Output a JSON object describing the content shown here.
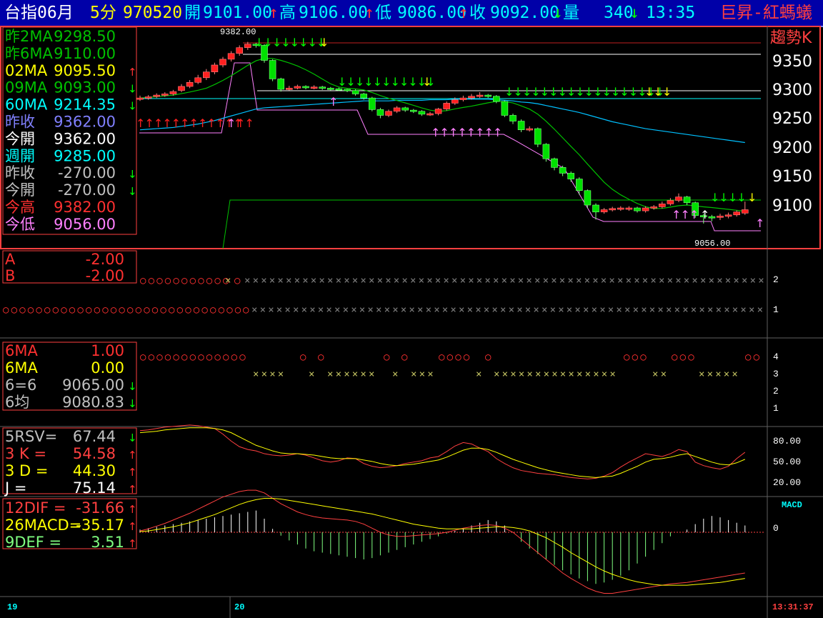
{
  "header": {
    "symbol": "台指06月",
    "period": "5分",
    "date": "970520",
    "open_label": "開",
    "open": "9101.00",
    "high_label": "高",
    "high": "9106.00",
    "low_label": "低",
    "low": "9086.00",
    "close_label": "收",
    "close": "9092.00",
    "volume_label": "量",
    "volume": "340",
    "time": "13:35",
    "brand": "巨昇-紅螞蟻"
  },
  "main_panel": {
    "mode_label": "趨勢K",
    "high_marker": "9382.00",
    "low_marker": "9056.00",
    "y_ticks": [
      "9350",
      "9300",
      "9250",
      "9200",
      "9150",
      "9100"
    ],
    "legend": [
      {
        "label": "昨2MA",
        "value": "9298.50",
        "color": "#00c000",
        "arrow": ""
      },
      {
        "label": "昨6MA",
        "value": "9110.00",
        "color": "#00c000",
        "arrow": ""
      },
      {
        "label": "02MA",
        "value": "9095.50",
        "color": "#ffff00",
        "arrow": "up"
      },
      {
        "label": "09MA",
        "value": "9093.00",
        "color": "#00c000",
        "arrow": "down"
      },
      {
        "label": "60MA",
        "value": "9214.35",
        "color": "#00ffff",
        "arrow": "down"
      },
      {
        "label": "昨收",
        "value": "9362.00",
        "color": "#8080ff",
        "arrow": ""
      },
      {
        "label": "今開",
        "value": "9362.00",
        "color": "#ffffff",
        "arrow": ""
      },
      {
        "label": "週開",
        "value": "9285.00",
        "color": "#00ffff",
        "arrow": ""
      },
      {
        "label": "昨收",
        "value": "-270.00",
        "color": "#c0c0c0",
        "arrow": "down"
      },
      {
        "label": "今開",
        "value": "-270.00",
        "color": "#c0c0c0",
        "arrow": "down"
      },
      {
        "label": "今高",
        "value": "9382.00",
        "color": "#ff3030",
        "arrow": ""
      },
      {
        "label": "今低",
        "value": "9056.00",
        "color": "#ff80ff",
        "arrow": ""
      }
    ]
  },
  "signal_panel_1": {
    "legend": [
      {
        "label": "A",
        "value": "-2.00",
        "color": "#ff3030"
      },
      {
        "label": "B",
        "value": "-2.00",
        "color": "#ff3030"
      }
    ],
    "y_ticks": [
      "2",
      "1"
    ]
  },
  "signal_panel_2": {
    "legend": [
      {
        "label": "6MA",
        "value": "1.00",
        "color": "#ff3030",
        "arrow": ""
      },
      {
        "label": "6MA",
        "value": "0.00",
        "color": "#ffff00",
        "arrow": ""
      },
      {
        "label": "6=6",
        "value": "9065.00",
        "color": "#c0c0c0",
        "arrow": "down"
      },
      {
        "label": "6均",
        "value": "9080.83",
        "color": "#c0c0c0",
        "arrow": "down"
      }
    ],
    "y_ticks": [
      "4",
      "3",
      "2",
      "1"
    ]
  },
  "kd_panel": {
    "legend": [
      {
        "label": "5RSV=",
        "value": "67.44",
        "color": "#c0c0c0",
        "arrow": "down"
      },
      {
        "label": "3 K =",
        "value": "54.58",
        "color": "#ff4040",
        "arrow": "up"
      },
      {
        "label": "3 D =",
        "value": "44.30",
        "color": "#ffff00",
        "arrow": "up"
      },
      {
        "label": "J =",
        "value": "75.14",
        "color": "#ffffff",
        "arrow": "up"
      }
    ],
    "y_ticks": [
      "80.00",
      "50.00",
      "20.00"
    ]
  },
  "macd_panel": {
    "title": "MACD",
    "legend": [
      {
        "label": "12DIF =",
        "value": "-31.66",
        "color": "#ff4040",
        "arrow": "up"
      },
      {
        "label": "26MACD=",
        "value": "-35.17",
        "color": "#ffff00",
        "arrow": "up"
      },
      {
        "label": "9DEF =",
        "value": "3.51",
        "color": "#80ff80",
        "arrow": "up"
      }
    ],
    "y_ticks": [
      "0"
    ]
  },
  "footer": {
    "day_1": "19",
    "day_2": "20",
    "clock": "13:31:37"
  },
  "chart_data": {
    "type": "candlestick",
    "close": [
      9285,
      9287,
      9290,
      9292,
      9296,
      9305,
      9312,
      9320,
      9330,
      9342,
      9352,
      9362,
      9372,
      9378,
      9376,
      9350,
      9318,
      9300,
      9302,
      9305,
      9303,
      9304,
      9302,
      9301,
      9300,
      9298,
      9292,
      9285,
      9265,
      9255,
      9262,
      9268,
      9264,
      9262,
      9257,
      9258,
      9266,
      9276,
      9282,
      9285,
      9288,
      9290,
      9288,
      9279,
      9255,
      9245,
      9230,
      9232,
      9205,
      9180,
      9165,
      9155,
      9145,
      9125,
      9100,
      9088,
      9092,
      9094,
      9095,
      9095,
      9090,
      9095,
      9097,
      9102,
      9108,
      9114,
      9104,
      9082,
      9080,
      9079,
      9081,
      9083,
      9088,
      9092
    ],
    "open": [
      9283,
      9285,
      9288,
      9290,
      9292,
      9298,
      9305,
      9312,
      9320,
      9330,
      9342,
      9352,
      9362,
      9372,
      9378,
      9376,
      9350,
      9318,
      9300,
      9302,
      9305,
      9303,
      9304,
      9302,
      9301,
      9300,
      9298,
      9292,
      9285,
      9265,
      9255,
      9262,
      9268,
      9264,
      9262,
      9257,
      9258,
      9266,
      9276,
      9282,
      9285,
      9288,
      9290,
      9288,
      9279,
      9255,
      9245,
      9230,
      9232,
      9205,
      9180,
      9165,
      9155,
      9145,
      9125,
      9100,
      9088,
      9092,
      9094,
      9095,
      9095,
      9090,
      9095,
      9097,
      9102,
      9108,
      9114,
      9104,
      9082,
      9080,
      9079,
      9081,
      9083,
      9086
    ],
    "high": [
      9289,
      9290,
      9293,
      9295,
      9299,
      9309,
      9316,
      9325,
      9335,
      9346,
      9356,
      9366,
      9376,
      9382,
      9380,
      9378,
      9352,
      9320,
      9306,
      9308,
      9307,
      9307,
      9306,
      9304,
      9303,
      9301,
      9300,
      9294,
      9287,
      9268,
      9265,
      9271,
      9270,
      9266,
      9264,
      9261,
      9268,
      9279,
      9286,
      9289,
      9292,
      9295,
      9292,
      9290,
      9281,
      9258,
      9248,
      9236,
      9234,
      9207,
      9182,
      9168,
      9158,
      9148,
      9127,
      9103,
      9095,
      9097,
      9098,
      9098,
      9097,
      9098,
      9100,
      9106,
      9112,
      9120,
      9116,
      9106,
      9085,
      9083,
      9085,
      9087,
      9091,
      9106
    ],
    "low": [
      9280,
      9282,
      9285,
      9287,
      9289,
      9295,
      9302,
      9309,
      9316,
      9326,
      9338,
      9348,
      9358,
      9368,
      9372,
      9346,
      9314,
      9296,
      9298,
      9300,
      9300,
      9300,
      9299,
      9298,
      9297,
      9295,
      9289,
      9282,
      9262,
      9250,
      9252,
      9259,
      9261,
      9259,
      9254,
      9254,
      9255,
      9263,
      9273,
      9279,
      9282,
      9285,
      9285,
      9276,
      9252,
      9240,
      9226,
      9227,
      9200,
      9175,
      9160,
      9150,
      9140,
      9118,
      9095,
      9075,
      9085,
      9089,
      9090,
      9090,
      9087,
      9087,
      9092,
      9094,
      9099,
      9105,
      9100,
      9078,
      9068,
      9072,
      9074,
      9077,
      9080,
      9083
    ],
    "ma_long": [
      9230,
      9231,
      9232,
      9233,
      9234,
      9236,
      9238,
      9240,
      9243,
      9246,
      9250,
      9254,
      9258,
      9262,
      9266,
      9268,
      9269,
      9270,
      9271,
      9272,
      9273,
      9274,
      9275,
      9276,
      9277,
      9278,
      9279,
      9280,
      9280,
      9280,
      9280,
      9281,
      9281,
      9281,
      9281,
      9282,
      9282,
      9282,
      9283,
      9283,
      9283,
      9283,
      9283,
      9282,
      9281,
      9280,
      9278,
      9277,
      9275,
      9272,
      9269,
      9266,
      9263,
      9260,
      9256,
      9252,
      9248,
      9244,
      9241,
      9238,
      9235,
      9232,
      9230,
      9228,
      9226,
      9224,
      9222,
      9220,
      9218,
      9216,
      9214,
      9212,
      9210,
      9208
    ],
    "kd_k": [
      85,
      86,
      88,
      90,
      91,
      92,
      93,
      92,
      90,
      88,
      80,
      70,
      62,
      58,
      56,
      52,
      50,
      49,
      50,
      52,
      50,
      46,
      42,
      40,
      42,
      46,
      45,
      38,
      34,
      32,
      33,
      35,
      38,
      40,
      42,
      46,
      48,
      55,
      63,
      68,
      66,
      60,
      55,
      45,
      38,
      32,
      28,
      26,
      24,
      23,
      22,
      20,
      18,
      17,
      16,
      17,
      20,
      25,
      33,
      40,
      46,
      52,
      50,
      48,
      52,
      58,
      55,
      40,
      35,
      32,
      30,
      34,
      45,
      54
    ],
    "kd_d": [
      82,
      83,
      84,
      86,
      87,
      88,
      89,
      89,
      89,
      88,
      86,
      82,
      76,
      70,
      64,
      60,
      56,
      53,
      52,
      52,
      51,
      50,
      48,
      46,
      45,
      45,
      45,
      43,
      41,
      38,
      36,
      35,
      36,
      37,
      39,
      41,
      43,
      47,
      52,
      57,
      60,
      60,
      58,
      54,
      49,
      44,
      40,
      36,
      32,
      29,
      26,
      24,
      22,
      20,
      19,
      18,
      19,
      20,
      24,
      29,
      34,
      40,
      44,
      45,
      47,
      50,
      52,
      48,
      44,
      40,
      37,
      36,
      39,
      44
    ],
    "macd_hist": [
      4,
      6,
      8,
      10,
      12,
      14,
      16,
      18,
      20,
      22,
      24,
      26,
      28,
      30,
      32,
      20,
      5,
      -5,
      -12,
      -18,
      -24,
      -28,
      -30,
      -32,
      -34,
      -36,
      -38,
      -40,
      -38,
      -34,
      -30,
      -26,
      -22,
      -18,
      -14,
      -10,
      -6,
      -2,
      2,
      6,
      10,
      14,
      18,
      16,
      10,
      0,
      -14,
      -24,
      -32,
      -40,
      -48,
      -56,
      -62,
      -68,
      -72,
      -76,
      -74,
      -70,
      -64,
      -56,
      -46,
      -36,
      -26,
      -16,
      -6,
      0,
      4,
      12,
      20,
      24,
      22,
      18,
      14,
      10
    ],
    "macd_dif": [
      2,
      5,
      9,
      13,
      18,
      23,
      28,
      34,
      40,
      46,
      52,
      56,
      60,
      62,
      62,
      58,
      50,
      42,
      36,
      30,
      26,
      23,
      21,
      20,
      19,
      18,
      16,
      12,
      6,
      0,
      -4,
      -6,
      -6,
      -5,
      -4,
      -3,
      -2,
      0,
      3,
      6,
      8,
      10,
      11,
      10,
      6,
      0,
      -10,
      -20,
      -30,
      -40,
      -50,
      -60,
      -68,
      -75,
      -82,
      -87,
      -90,
      -90,
      -88,
      -86,
      -84,
      -82,
      -80,
      -78,
      -76,
      -75,
      -74,
      -72,
      -70,
      -68,
      -66,
      -64,
      -62,
      -60
    ],
    "macd_dem": [
      1,
      2,
      4,
      6,
      8,
      11,
      14,
      18,
      22,
      26,
      31,
      36,
      41,
      45,
      48,
      50,
      50,
      49,
      47,
      45,
      43,
      41,
      39,
      37,
      35,
      33,
      31,
      29,
      27,
      24,
      21,
      18,
      15,
      12,
      10,
      8,
      6,
      5,
      5,
      5,
      5,
      6,
      7,
      8,
      8,
      7,
      5,
      2,
      -3,
      -8,
      -15,
      -22,
      -30,
      -37,
      -44,
      -51,
      -57,
      -62,
      -66,
      -70,
      -73,
      -75,
      -77,
      -78,
      -78,
      -78,
      -78,
      -77,
      -76,
      -75,
      -74,
      -72,
      -70,
      -68
    ]
  }
}
